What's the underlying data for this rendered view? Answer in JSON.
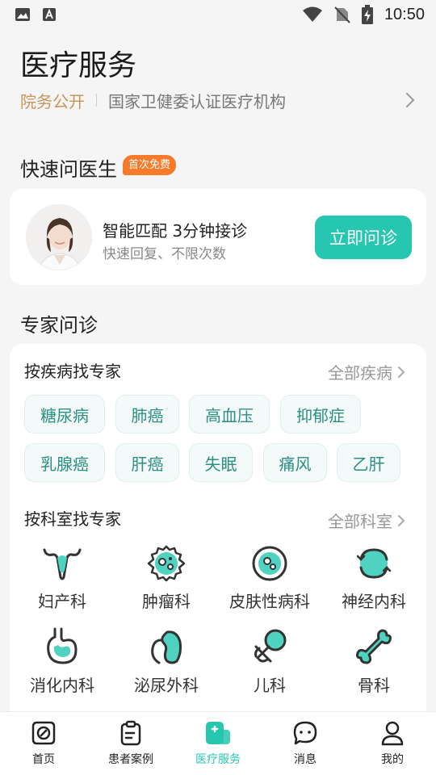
{
  "status_bar": {
    "time": "10:50",
    "icons": [
      "image-icon",
      "a-icon",
      "wifi-icon",
      "no-sim-icon",
      "battery-charging-icon"
    ]
  },
  "page": {
    "title": "医疗服务",
    "hospital_tag": "院务公开",
    "hospital_desc": "国家卫健委认证医疗机构"
  },
  "quick": {
    "section_title": "快速问医生",
    "badge": "首次免费",
    "title": "智能匹配 3分钟接诊",
    "subtitle": "快速回复、不限次数",
    "button": "立即问诊"
  },
  "expert": {
    "section_title": "专家问诊",
    "disease_title": "按疾病找专家",
    "disease_all": "全部疾病",
    "diseases": [
      "糖尿病",
      "肺癌",
      "高血压",
      "抑郁症",
      "乳腺癌",
      "肝癌",
      "失眠",
      "痛风",
      "乙肝"
    ],
    "dept_title": "按科室找专家",
    "dept_all": "全部科室",
    "departments": [
      {
        "label": "妇产科",
        "icon": "uterus-icon"
      },
      {
        "label": "肿瘤科",
        "icon": "tumor-cell-icon"
      },
      {
        "label": "皮肤性病科",
        "icon": "skin-cell-icon"
      },
      {
        "label": "神经内科",
        "icon": "brain-icon"
      },
      {
        "label": "消化内科",
        "icon": "stomach-icon"
      },
      {
        "label": "泌尿外科",
        "icon": "kidney-icon"
      },
      {
        "label": "儿科",
        "icon": "pacifier-icon"
      },
      {
        "label": "骨科",
        "icon": "bone-icon"
      }
    ]
  },
  "tabs": [
    {
      "label": "首页",
      "icon": "home-icon"
    },
    {
      "label": "患者案例",
      "icon": "clipboard-icon"
    },
    {
      "label": "医疗服务",
      "icon": "medical-service-icon",
      "active": true
    },
    {
      "label": "消息",
      "icon": "chat-icon"
    },
    {
      "label": "我的",
      "icon": "user-icon"
    }
  ],
  "colors": {
    "accent": "#26c6b0",
    "badge": "#f57b2a",
    "gold": "#c4965a",
    "chip_text": "#2b8f82"
  }
}
